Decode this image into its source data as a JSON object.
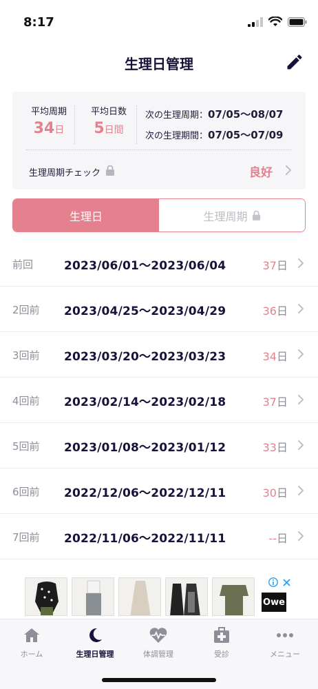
{
  "status": {
    "time": "8:17"
  },
  "header": {
    "title": "生理日管理",
    "edit_icon": "pencil-icon"
  },
  "summary": {
    "avg_cycle": {
      "label": "平均周期",
      "value": "34",
      "unit": "日"
    },
    "avg_days": {
      "label": "平均日数",
      "value": "5",
      "unit": "日間"
    },
    "next_cycle": {
      "label": "次の生理周期：",
      "value": "07/05〜08/07"
    },
    "next_period": {
      "label": "次の生理期間：",
      "value": "07/05〜07/09"
    },
    "check": {
      "label": "生理周期チェック",
      "value": "良好"
    }
  },
  "tabs": [
    {
      "label": "生理日",
      "active": true
    },
    {
      "label": "生理周期",
      "active": false,
      "locked": true
    }
  ],
  "records": [
    {
      "label": "前回",
      "range": "2023/06/01〜2023/06/04",
      "days": "37",
      "unit": "日"
    },
    {
      "label": "2回前",
      "range": "2023/04/25〜2023/04/29",
      "days": "36",
      "unit": "日"
    },
    {
      "label": "3回前",
      "range": "2023/03/20〜2023/03/23",
      "days": "34",
      "unit": "日"
    },
    {
      "label": "4回前",
      "range": "2023/02/14〜2023/02/18",
      "days": "37",
      "unit": "日"
    },
    {
      "label": "5回前",
      "range": "2023/01/08〜2023/01/12",
      "days": "33",
      "unit": "日"
    },
    {
      "label": "6回前",
      "range": "2022/12/06〜2022/12/11",
      "days": "30",
      "unit": "日"
    },
    {
      "label": "7回前",
      "range": "2022/11/06〜2022/11/11",
      "days": "--",
      "unit": "日"
    }
  ],
  "ad": {
    "brand": "Owe"
  },
  "tabbar": [
    {
      "label": "ホーム",
      "icon": "home-icon"
    },
    {
      "label": "生理日管理",
      "icon": "moon-icon",
      "active": true
    },
    {
      "label": "体調管理",
      "icon": "heart-pulse-icon"
    },
    {
      "label": "受診",
      "icon": "medical-cross-icon"
    },
    {
      "label": "メニュー",
      "icon": "more-icon"
    }
  ],
  "colors": {
    "accent": "#e5808f",
    "text": "#15133a",
    "muted": "#8e8e98"
  }
}
